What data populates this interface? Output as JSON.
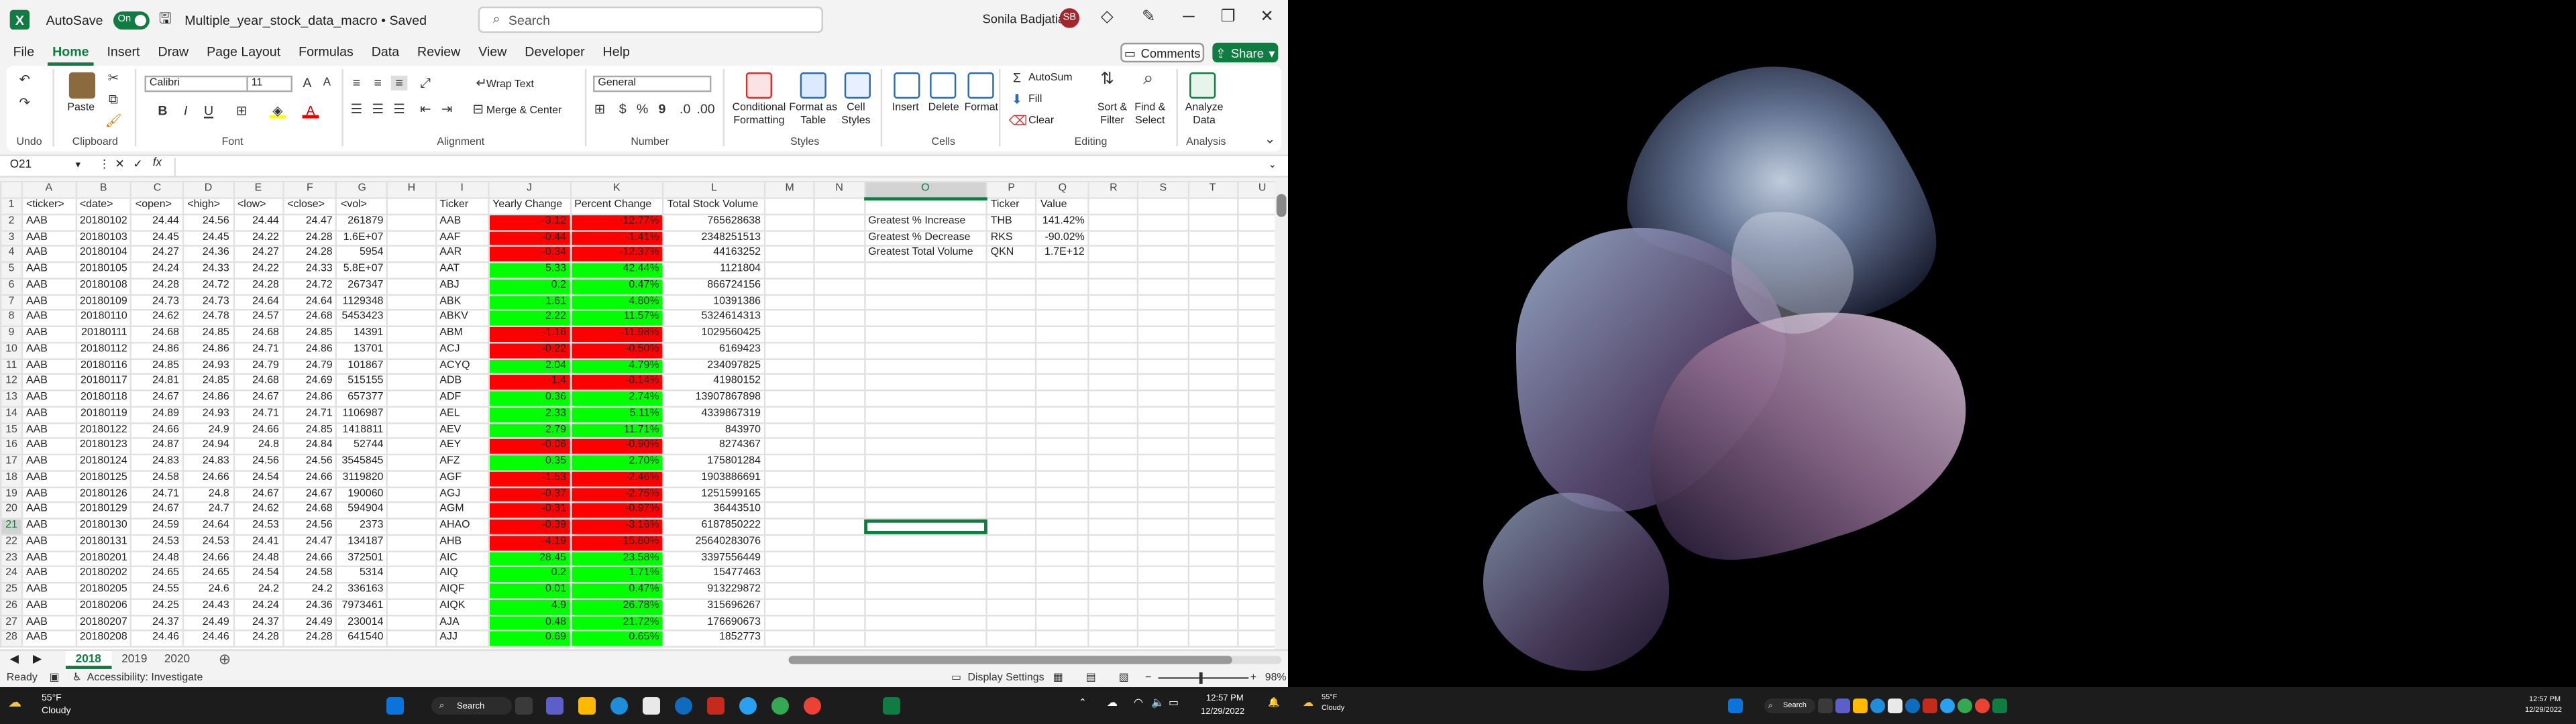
{
  "window": {
    "autosave_label": "AutoSave",
    "autosave_state": "On",
    "file_title": "Multiple_year_stock_data_macro • Saved",
    "search_placeholder": "Search",
    "user_name": "Sonila Badjatia",
    "user_initials": "SB"
  },
  "menu": [
    "File",
    "Home",
    "Insert",
    "Draw",
    "Page Layout",
    "Formulas",
    "Data",
    "Review",
    "View",
    "Developer",
    "Help"
  ],
  "menu_active": "Home",
  "comments_label": "Comments",
  "share_label": "Share",
  "ribbon": {
    "undo": "Undo",
    "paste": "Paste",
    "clipboard": "Clipboard",
    "font_name": "Calibri",
    "font_size": "11",
    "font": "Font",
    "wrap_text": "Wrap Text",
    "merge_center": "Merge & Center",
    "alignment": "Alignment",
    "number_format": "General",
    "number": "Number",
    "conditional_formatting": "Conditional Formatting",
    "format_as_table": "Format as Table",
    "cell_styles": "Cell Styles",
    "styles": "Styles",
    "insert": "Insert",
    "delete": "Delete",
    "format": "Format",
    "cells": "Cells",
    "autosum": "AutoSum",
    "fill": "Fill",
    "clear": "Clear",
    "sort_filter": "Sort & Filter",
    "find_select": "Find & Select",
    "editing": "Editing",
    "analyze_data": "Analyze Data",
    "analysis": "Analysis",
    "bold": "B",
    "italic": "I",
    "underline": "U",
    "dollar": "$",
    "percent": "%"
  },
  "name_box": "O21",
  "fx": "fx",
  "columns": [
    "A",
    "B",
    "C",
    "D",
    "E",
    "F",
    "G",
    "H",
    "I",
    "J",
    "K",
    "L",
    "M",
    "N",
    "O",
    "P",
    "Q",
    "R",
    "S",
    "T",
    "U"
  ],
  "rows": [
    [
      "<ticker>",
      "<date>",
      "<open>",
      "<high>",
      "<low>",
      "<close>",
      "<vol>",
      "",
      "Ticker",
      "Yearly Change",
      "Percent Change",
      "Total Stock Volume",
      "",
      "",
      "",
      "Ticker",
      "Value"
    ],
    [
      "AAB",
      "20180102",
      "24.44",
      "24.56",
      "24.44",
      "24.47",
      "261879",
      "",
      "AAB",
      "-3.12",
      "-12.77%",
      "765628638",
      "",
      "",
      "Greatest % Increase",
      "THB",
      "141.42%"
    ],
    [
      "AAB",
      "20180103",
      "24.45",
      "24.45",
      "24.22",
      "24.28",
      "1.6E+07",
      "",
      "AAF",
      "-0.44",
      "-1.41%",
      "2348251513",
      "",
      "",
      "Greatest % Decrease",
      "RKS",
      "-90.02%"
    ],
    [
      "AAB",
      "20180104",
      "24.27",
      "24.36",
      "24.27",
      "24.28",
      "5954",
      "",
      "AAR",
      "-0.34",
      "-12.37%",
      "44163252",
      "",
      "",
      "Greatest Total Volume",
      "QKN",
      "1.7E+12"
    ],
    [
      "AAB",
      "20180105",
      "24.24",
      "24.33",
      "24.22",
      "24.33",
      "5.8E+07",
      "",
      "AAT",
      "5.33",
      "42.44%",
      "1121804",
      "",
      "",
      "",
      "",
      ""
    ],
    [
      "AAB",
      "20180108",
      "24.28",
      "24.72",
      "24.28",
      "24.72",
      "267347",
      "",
      "ABJ",
      "0.2",
      "0.47%",
      "866724156",
      "",
      "",
      "",
      "",
      ""
    ],
    [
      "AAB",
      "20180109",
      "24.73",
      "24.73",
      "24.64",
      "24.64",
      "1129348",
      "",
      "ABK",
      "1.61",
      "4.80%",
      "10391386",
      "",
      "",
      "",
      "",
      ""
    ],
    [
      "AAB",
      "20180110",
      "24.62",
      "24.78",
      "24.57",
      "24.68",
      "5453423",
      "",
      "ABKV",
      "2.22",
      "11.57%",
      "5324614313",
      "",
      "",
      "",
      "",
      ""
    ],
    [
      "AAB",
      "20180111",
      "24.68",
      "24.85",
      "24.68",
      "24.85",
      "14391",
      "",
      "ABM",
      "-1.16",
      "-11.98%",
      "1029560425",
      "",
      "",
      "",
      "",
      ""
    ],
    [
      "AAB",
      "20180112",
      "24.86",
      "24.86",
      "24.71",
      "24.86",
      "13701",
      "",
      "ACJ",
      "-0.22",
      "-0.50%",
      "6169423",
      "",
      "",
      "",
      "",
      ""
    ],
    [
      "AAB",
      "20180116",
      "24.85",
      "24.93",
      "24.79",
      "24.79",
      "101867",
      "",
      "ACYQ",
      "2.04",
      "4.79%",
      "234097825",
      "",
      "",
      "",
      "",
      ""
    ],
    [
      "AAB",
      "20180117",
      "24.81",
      "24.85",
      "24.68",
      "24.69",
      "515155",
      "",
      "ADB",
      "-1.4",
      "-8.14%",
      "41980152",
      "",
      "",
      "",
      "",
      ""
    ],
    [
      "AAB",
      "20180118",
      "24.67",
      "24.86",
      "24.67",
      "24.86",
      "657377",
      "",
      "ADF",
      "0.36",
      "2.74%",
      "13907867898",
      "",
      "",
      "",
      "",
      ""
    ],
    [
      "AAB",
      "20180119",
      "24.89",
      "24.93",
      "24.71",
      "24.71",
      "1106987",
      "",
      "AEL",
      "2.33",
      "5.11%",
      "4339867319",
      "",
      "",
      "",
      "",
      ""
    ],
    [
      "AAB",
      "20180122",
      "24.66",
      "24.9",
      "24.66",
      "24.85",
      "1418811",
      "",
      "AEV",
      "2.79",
      "11.71%",
      "843970",
      "",
      "",
      "",
      "",
      ""
    ],
    [
      "AAB",
      "20180123",
      "24.87",
      "24.94",
      "24.8",
      "24.84",
      "52744",
      "",
      "AEY",
      "-0.06",
      "-0.90%",
      "8274367",
      "",
      "",
      "",
      "",
      ""
    ],
    [
      "AAB",
      "20180124",
      "24.83",
      "24.83",
      "24.56",
      "24.56",
      "3545845",
      "",
      "AFZ",
      "0.35",
      "2.70%",
      "175801284",
      "",
      "",
      "",
      "",
      ""
    ],
    [
      "AAB",
      "20180125",
      "24.58",
      "24.66",
      "24.54",
      "24.66",
      "3119820",
      "",
      "AGF",
      "-1.53",
      "-2.46%",
      "1903886691",
      "",
      "",
      "",
      "",
      ""
    ],
    [
      "AAB",
      "20180126",
      "24.71",
      "24.8",
      "24.67",
      "24.67",
      "190060",
      "",
      "AGJ",
      "-0.37",
      "-2.75%",
      "1251599165",
      "",
      "",
      "",
      "",
      ""
    ],
    [
      "AAB",
      "20180129",
      "24.67",
      "24.7",
      "24.62",
      "24.68",
      "594904",
      "",
      "AGM",
      "-0.31",
      "-0.97%",
      "36443510",
      "",
      "",
      "",
      "",
      ""
    ],
    [
      "AAB",
      "20180130",
      "24.59",
      "24.64",
      "24.53",
      "24.56",
      "2373",
      "",
      "AHAO",
      "-0.39",
      "-3.16%",
      "6187850222",
      "",
      "",
      "",
      "",
      ""
    ],
    [
      "AAB",
      "20180131",
      "24.53",
      "24.53",
      "24.41",
      "24.47",
      "134187",
      "",
      "AHB",
      "-4.19",
      "-15.80%",
      "25640283076",
      "",
      "",
      "",
      "",
      ""
    ],
    [
      "AAB",
      "20180201",
      "24.48",
      "24.66",
      "24.48",
      "24.66",
      "372501",
      "",
      "AIC",
      "28.45",
      "23.58%",
      "3397556449",
      "",
      "",
      "",
      "",
      ""
    ],
    [
      "AAB",
      "20180202",
      "24.65",
      "24.65",
      "24.54",
      "24.58",
      "5314",
      "",
      "AIQ",
      "0.2",
      "1.71%",
      "15477463",
      "",
      "",
      "",
      "",
      ""
    ],
    [
      "AAB",
      "20180205",
      "24.55",
      "24.6",
      "24.2",
      "24.2",
      "336163",
      "",
      "AIQF",
      "0.01",
      "0.47%",
      "913229872",
      "",
      "",
      "",
      "",
      ""
    ],
    [
      "AAB",
      "20180206",
      "24.25",
      "24.43",
      "24.24",
      "24.36",
      "7973461",
      "",
      "AIQK",
      "4.9",
      "26.78%",
      "315696267",
      "",
      "",
      "",
      "",
      ""
    ],
    [
      "AAB",
      "20180207",
      "24.37",
      "24.49",
      "24.37",
      "24.49",
      "230014",
      "",
      "AJA",
      "0.48",
      "21.72%",
      "176690673",
      "",
      "",
      "",
      "",
      ""
    ],
    [
      "AAB",
      "20180208",
      "24.46",
      "24.46",
      "24.28",
      "24.28",
      "641540",
      "",
      "AJJ",
      "0.69",
      "0.65%",
      "1852773",
      "",
      "",
      "",
      "",
      ""
    ]
  ],
  "sheet_tabs": [
    "2018",
    "2019",
    "2020"
  ],
  "active_tab": "2018",
  "status": {
    "ready": "Ready",
    "accessibility": "Accessibility: Investigate",
    "display_settings": "Display Settings",
    "zoom": "98%"
  },
  "taskbar_left": {
    "weather_temp": "55°F",
    "weather_desc": "Cloudy",
    "search": "Search",
    "time": "12:57 PM",
    "date": "12/29/2022"
  },
  "taskbar_right": {
    "weather_temp": "55°F",
    "weather_desc": "Cloudy",
    "search": "Search",
    "time": "12:57 PM",
    "date": "12/29/2022"
  },
  "colors": {
    "excel_green": "#107c41",
    "positive": "#00ff00",
    "negative": "#ff0000"
  }
}
